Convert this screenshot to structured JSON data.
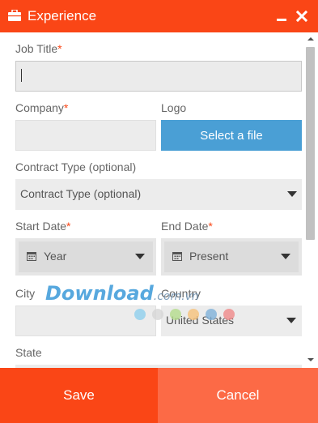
{
  "window": {
    "title": "Experience",
    "icon": "briefcase-icon",
    "accent_color": "#fa4616"
  },
  "form": {
    "job_title": {
      "label": "Job Title",
      "required_mark": "*",
      "value": ""
    },
    "company": {
      "label": "Company",
      "required_mark": "*",
      "value": ""
    },
    "logo": {
      "label": "Logo",
      "button_label": "Select a file"
    },
    "contract_type": {
      "label": "Contract Type (optional)",
      "selected": "Contract Type (optional)"
    },
    "start_date": {
      "label": "Start Date",
      "required_mark": "*",
      "selected": "Year"
    },
    "end_date": {
      "label": "End Date",
      "required_mark": "*",
      "selected": "Present"
    },
    "city": {
      "label": "City",
      "value": ""
    },
    "country": {
      "label": "Country",
      "selected": "United States"
    },
    "state": {
      "label": "State"
    }
  },
  "footer": {
    "save_label": "Save",
    "cancel_label": "Cancel"
  },
  "watermark": {
    "text": "Download",
    "suffix": ".com.vn"
  }
}
